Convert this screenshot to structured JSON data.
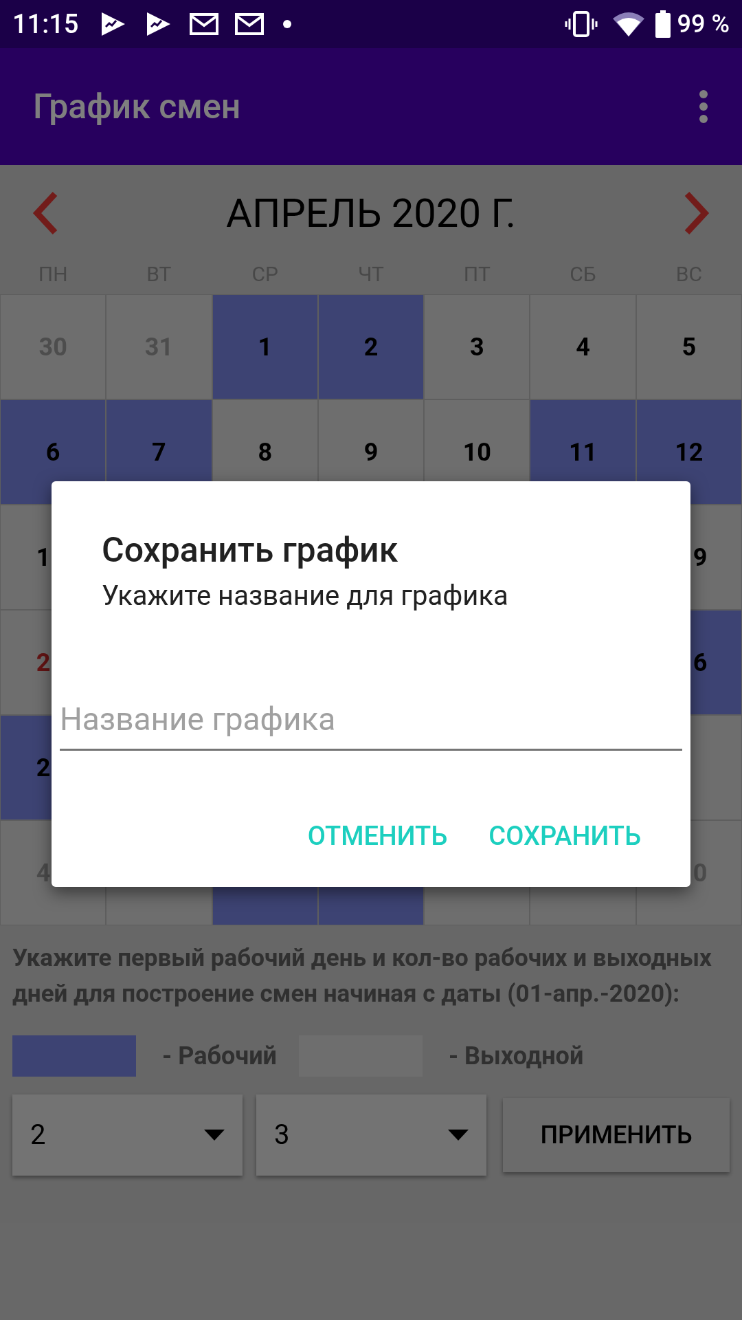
{
  "status_bar": {
    "time": "11:15",
    "battery": "99 %"
  },
  "app_bar": {
    "title": "График смен"
  },
  "calendar": {
    "month": "АПРЕЛЬ 2020 Г.",
    "weekdays": [
      "ПН",
      "ВТ",
      "СР",
      "ЧТ",
      "ПТ",
      "СБ",
      "ВС"
    ],
    "rows": [
      {
        "cells": [
          {
            "text": "30",
            "working": false,
            "other_month": true,
            "holiday": false
          },
          {
            "text": "31",
            "working": false,
            "other_month": true,
            "holiday": false
          },
          {
            "text": "1",
            "working": true,
            "other_month": false,
            "holiday": false
          },
          {
            "text": "2",
            "working": true,
            "other_month": false,
            "holiday": false
          },
          {
            "text": "3",
            "working": false,
            "other_month": false,
            "holiday": false
          },
          {
            "text": "4",
            "working": false,
            "other_month": false,
            "holiday": false
          },
          {
            "text": "5",
            "working": false,
            "other_month": false,
            "holiday": false
          }
        ]
      },
      {
        "cells": [
          {
            "text": "6",
            "working": true,
            "other_month": false,
            "holiday": false
          },
          {
            "text": "7",
            "working": true,
            "other_month": false,
            "holiday": false
          },
          {
            "text": "8",
            "working": false,
            "other_month": false,
            "holiday": false
          },
          {
            "text": "9",
            "working": false,
            "other_month": false,
            "holiday": false
          },
          {
            "text": "10",
            "working": false,
            "other_month": false,
            "holiday": false
          },
          {
            "text": "11",
            "working": true,
            "other_month": false,
            "holiday": false
          },
          {
            "text": "12",
            "working": true,
            "other_month": false,
            "holiday": false
          }
        ]
      },
      {
        "cells": [
          {
            "text": "1",
            "working": false,
            "other_month": false,
            "holiday": false
          },
          {
            "text": "9",
            "working": false,
            "other_month": false,
            "holiday": false
          }
        ]
      },
      {
        "cells": [
          {
            "text": "2",
            "working": false,
            "other_month": false,
            "holiday": true
          },
          {
            "text": "6",
            "working": true,
            "other_month": false,
            "holiday": false
          }
        ]
      },
      {
        "cells": [
          {
            "text": "2",
            "working": true,
            "other_month": false,
            "holiday": false
          },
          {
            "working": false
          }
        ]
      },
      {
        "cells": [
          {
            "text": "4",
            "working": false,
            "other_month": true,
            "holiday": false
          },
          {
            "working": false
          },
          {
            "working": true
          },
          {
            "working": true
          },
          {
            "working": false
          },
          {
            "working": false
          },
          {
            "text": "0",
            "working": false,
            "other_month": true,
            "holiday": false
          }
        ]
      }
    ]
  },
  "instructions": "Укажите первый рабочий день и кол-во рабочих и выходных дней для построение смен начиная с даты (01-апр.-2020):",
  "legend": [
    {
      "label": "- Рабочий",
      "working": true
    },
    {
      "label": "- Выходной",
      "working": false
    }
  ],
  "spinners": [
    {
      "value": "2"
    },
    {
      "value": "3"
    }
  ],
  "apply_button": "ПРИМЕНИТЬ",
  "dialog": {
    "title": "Сохранить график",
    "message": "Укажите название для графика",
    "input": {
      "placeholder": "Название графика"
    },
    "buttons": [
      "ОТМЕНИТЬ",
      "СОХРАНИТЬ"
    ]
  }
}
